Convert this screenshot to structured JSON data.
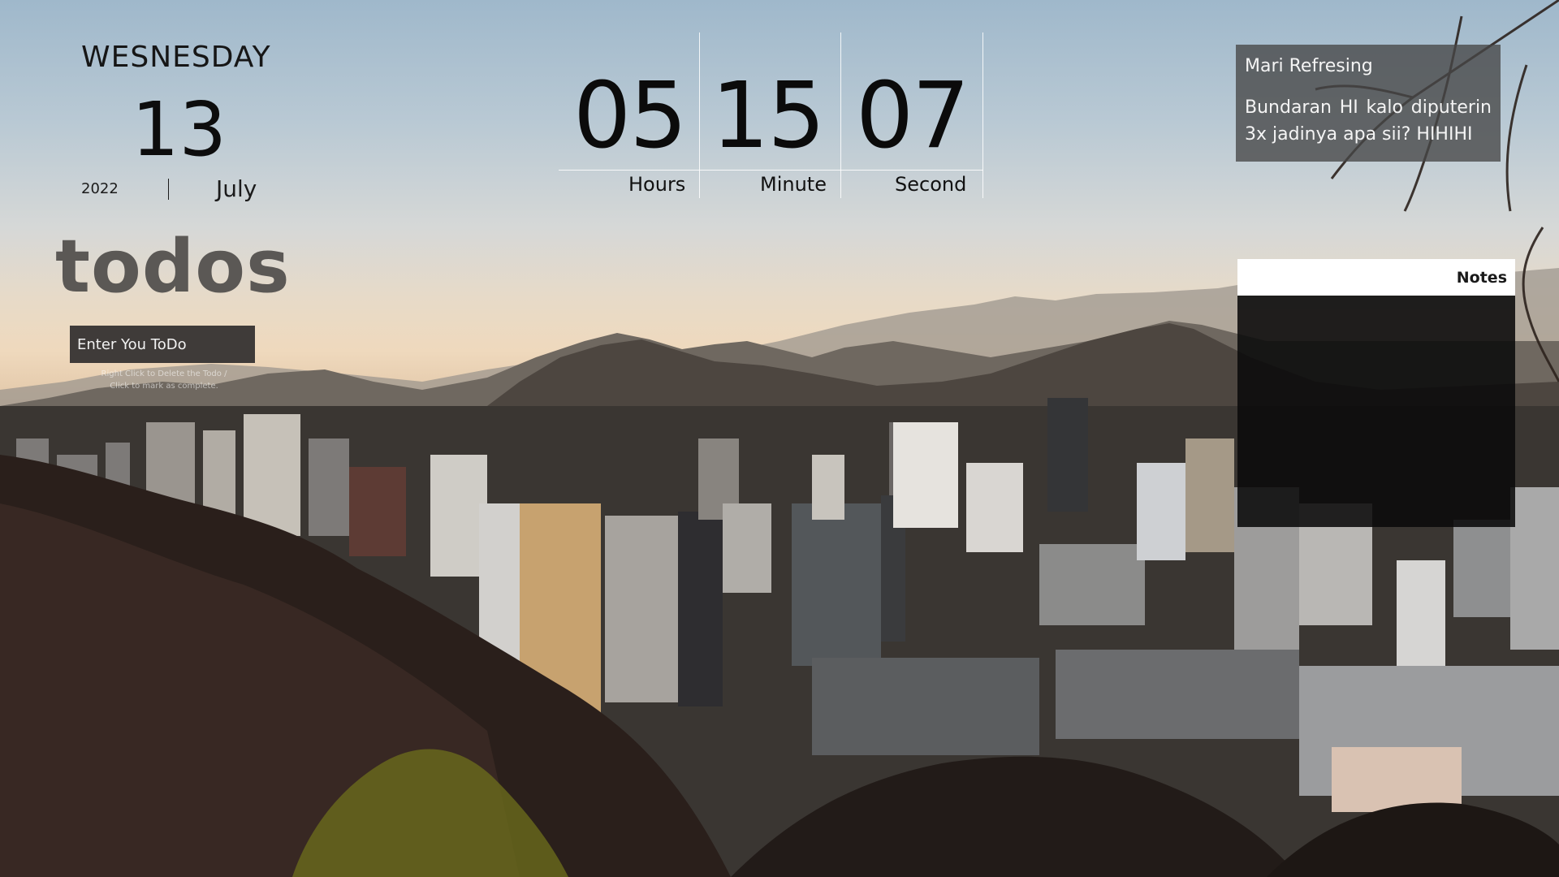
{
  "date": {
    "day_name": "WESNESDAY",
    "day_number": "13",
    "year": "2022",
    "month": "July"
  },
  "clock": {
    "hours": "05",
    "minutes": "15",
    "seconds": "07",
    "hours_label": "Hours",
    "minutes_label": "Minute",
    "seconds_label": "Second"
  },
  "todos": {
    "title": "todos",
    "input_placeholder": "Enter You ToDo",
    "hint": "Right Click to Delete the Todo / Click to mark as complete."
  },
  "quote": {
    "title": "Mari Refresing",
    "text": "Bundaran HI kalo diputerin 3x jadinya apa sii? HIHIHI"
  },
  "notes": {
    "header": "Notes"
  },
  "colors": {
    "todos_title": "#5b5855",
    "todo_input_bg": "#3f3b39",
    "quote_bg": "#464646",
    "notes_header_bg": "#ffffff",
    "notes_body_bg": "#0a0a0a"
  }
}
